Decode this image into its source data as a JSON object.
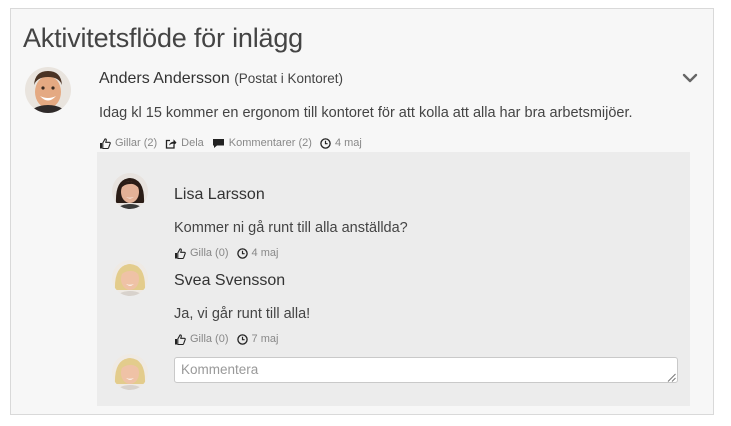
{
  "feed": {
    "title": "Aktivitetsflöde för inlägg"
  },
  "post": {
    "author": "Anders Andersson",
    "location": "(Postat i Kontoret)",
    "text": "Idag kl 15 kommer en ergonom till kontoret för att kolla att alla har bra arbetsmijöer.",
    "like_label": "Gillar (2)",
    "share_label": "Dela",
    "comments_label": "Kommentarer (2)",
    "date": "4 maj"
  },
  "comments": [
    {
      "author": "Lisa Larsson",
      "text": "Kommer ni gå runt till alla anställda?",
      "like_label": "Gilla (0)",
      "date": "4 maj"
    },
    {
      "author": "Svea Svensson",
      "text": "Ja, vi går runt till alla!",
      "like_label": "Gilla (0)",
      "date": "7 maj"
    }
  ],
  "comment_box": {
    "placeholder": "Kommentera"
  },
  "icons": {
    "menu": "chevron-down-icon",
    "like": "thumbs-up-icon",
    "share": "share-icon",
    "comments": "speech-bubble-icon",
    "date": "clock-icon"
  },
  "colors": {
    "icon": "#333333",
    "meta_text": "#888888",
    "comment_bg": "#ececec",
    "card_bg": "#f7f7f7"
  }
}
